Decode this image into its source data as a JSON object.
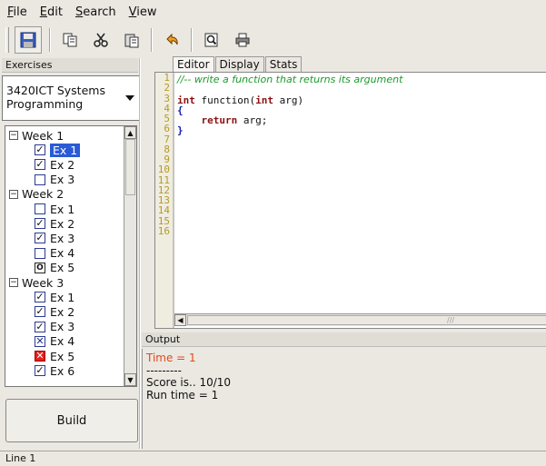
{
  "menu": [
    {
      "label": "File",
      "underline": "F"
    },
    {
      "label": "Edit",
      "underline": "E"
    },
    {
      "label": "Search",
      "underline": "S"
    },
    {
      "label": "View",
      "underline": "V"
    }
  ],
  "toolbar": {
    "icons": [
      "save-icon",
      "copy-icon",
      "cut-icon",
      "paste-icon",
      "undo-icon",
      "find-icon",
      "print-icon"
    ]
  },
  "left": {
    "header": "Exercises",
    "course": "3420ICT Systems Programming",
    "tree": [
      {
        "type": "week",
        "label": "Week 1"
      },
      {
        "type": "ex",
        "label": "Ex 1",
        "state": "checked",
        "selected": true
      },
      {
        "type": "ex",
        "label": "Ex 2",
        "state": "checked"
      },
      {
        "type": "ex",
        "label": "Ex 3",
        "state": "empty"
      },
      {
        "type": "week",
        "label": "Week 2"
      },
      {
        "type": "ex",
        "label": "Ex 1",
        "state": "empty"
      },
      {
        "type": "ex",
        "label": "Ex 2",
        "state": "checked"
      },
      {
        "type": "ex",
        "label": "Ex 3",
        "state": "checked"
      },
      {
        "type": "ex",
        "label": "Ex 4",
        "state": "empty"
      },
      {
        "type": "ex",
        "label": "Ex 5",
        "state": "circle"
      },
      {
        "type": "week",
        "label": "Week 3"
      },
      {
        "type": "ex",
        "label": "Ex 1",
        "state": "checked"
      },
      {
        "type": "ex",
        "label": "Ex 2",
        "state": "checked"
      },
      {
        "type": "ex",
        "label": "Ex 3",
        "state": "checked"
      },
      {
        "type": "ex",
        "label": "Ex 4",
        "state": "x-blue"
      },
      {
        "type": "ex",
        "label": "Ex 5",
        "state": "x-red"
      },
      {
        "type": "ex",
        "label": "Ex 6",
        "state": "checked"
      }
    ],
    "build_label": "Build"
  },
  "editor": {
    "tabs": [
      "Editor",
      "Display",
      "Stats"
    ],
    "active_tab": "Editor",
    "line_numbers": [
      "1",
      "2",
      "3",
      "4",
      "5",
      "6",
      "7",
      "8",
      "9",
      "10",
      "11",
      "12",
      "13",
      "14",
      "15",
      "16"
    ],
    "code_lines": [
      {
        "kind": "comment",
        "text": "//-- write a function that returns its argument"
      },
      {
        "kind": "blank",
        "text": ""
      },
      {
        "kind": "decl",
        "kw1": "int",
        "mid": " function(",
        "kw2": "int",
        "tail": " arg)"
      },
      {
        "kind": "brace",
        "text": "{"
      },
      {
        "kind": "ret",
        "indent": "    ",
        "kw": "return",
        "tail": " arg;"
      },
      {
        "kind": "brace",
        "text": "}"
      }
    ]
  },
  "output": {
    "header": "Output",
    "time_line": "Time = 1",
    "separator": "---------",
    "score": "Score is.. 10/10",
    "runtime": "Run time = 1"
  },
  "status": {
    "text": "Line 1"
  },
  "colors": {
    "selection": "#2a5bd7",
    "comment": "#1b9b2a",
    "keyword": "#8b1111",
    "brace": "#111caa",
    "time": "#e24a1d",
    "line_numbers": "#b59a2c"
  }
}
